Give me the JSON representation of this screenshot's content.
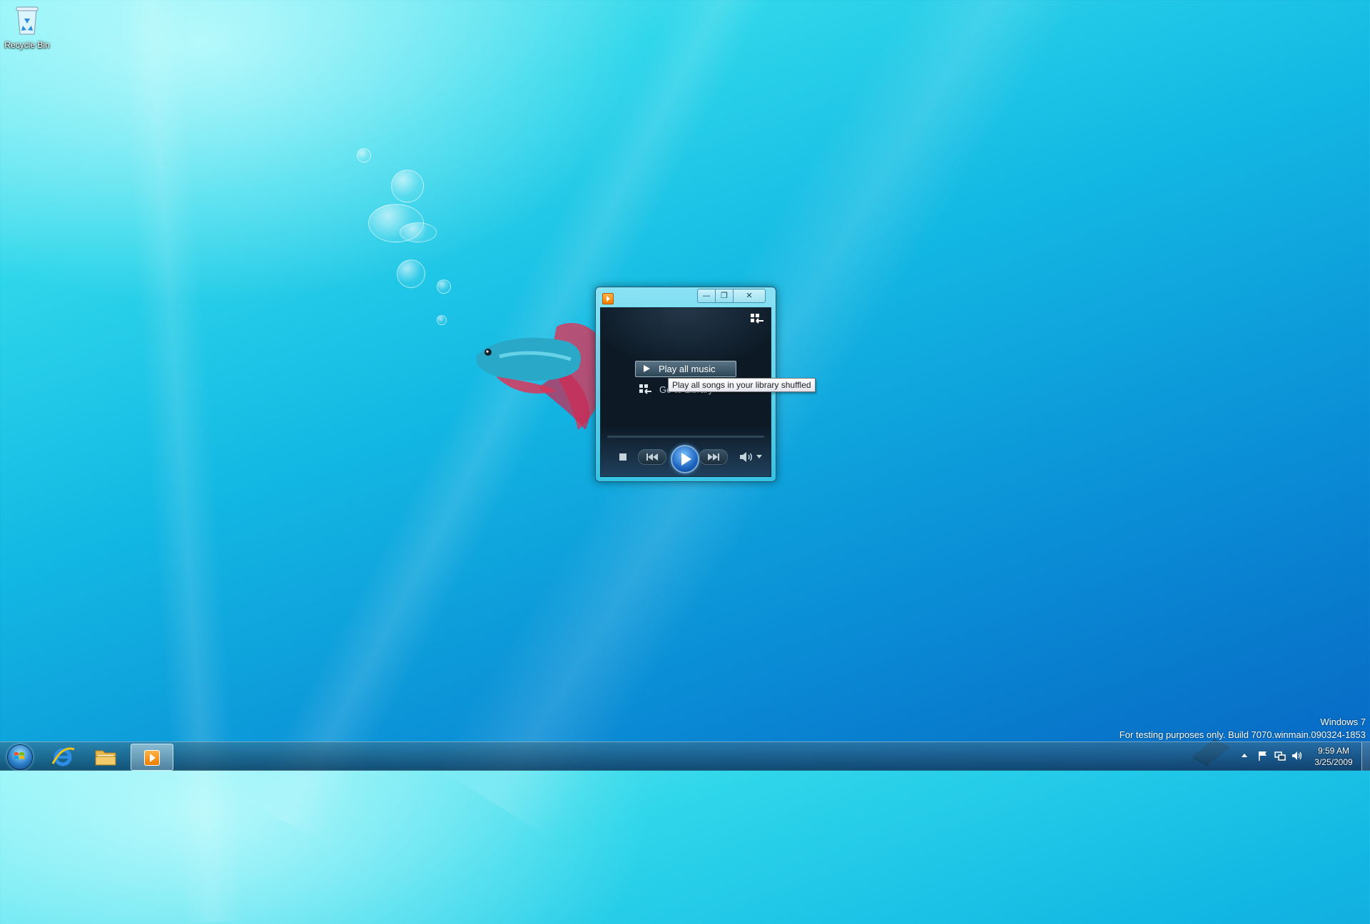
{
  "desktop": {
    "icons": [
      {
        "label": "Recycle Bin",
        "icon": "recycle-bin-icon"
      }
    ],
    "watermark": {
      "line1": "Windows 7",
      "line2": "For testing purposes only. Build 7070.winmain.090324-1853"
    }
  },
  "player": {
    "app_icon": "windows-media-player-icon",
    "caption_buttons": {
      "minimize": "—",
      "restore": "❐",
      "close": "✕"
    },
    "play_all_label": "Play all music",
    "go_to_library_label": "Go to Library",
    "tooltip": "Play all songs in your library shuffled",
    "controls": [
      "stop-icon",
      "previous-icon",
      "play-icon",
      "next-icon",
      "volume-icon",
      "chevron-down-icon"
    ]
  },
  "taskbar": {
    "pinned": [
      "start-orb-icon",
      "internet-explorer-icon",
      "windows-explorer-icon",
      "windows-media-player-icon"
    ],
    "tray_icons": [
      "show-hidden-icons-arrow",
      "action-center-flag-icon",
      "network-icon",
      "volume-icon"
    ],
    "clock": {
      "time": "9:59 AM",
      "date": "3/25/2009"
    }
  },
  "colors": {
    "desktop_accent": "#13b8e3",
    "player_background": "#0d1a26",
    "play_button": "#1d64c0"
  }
}
